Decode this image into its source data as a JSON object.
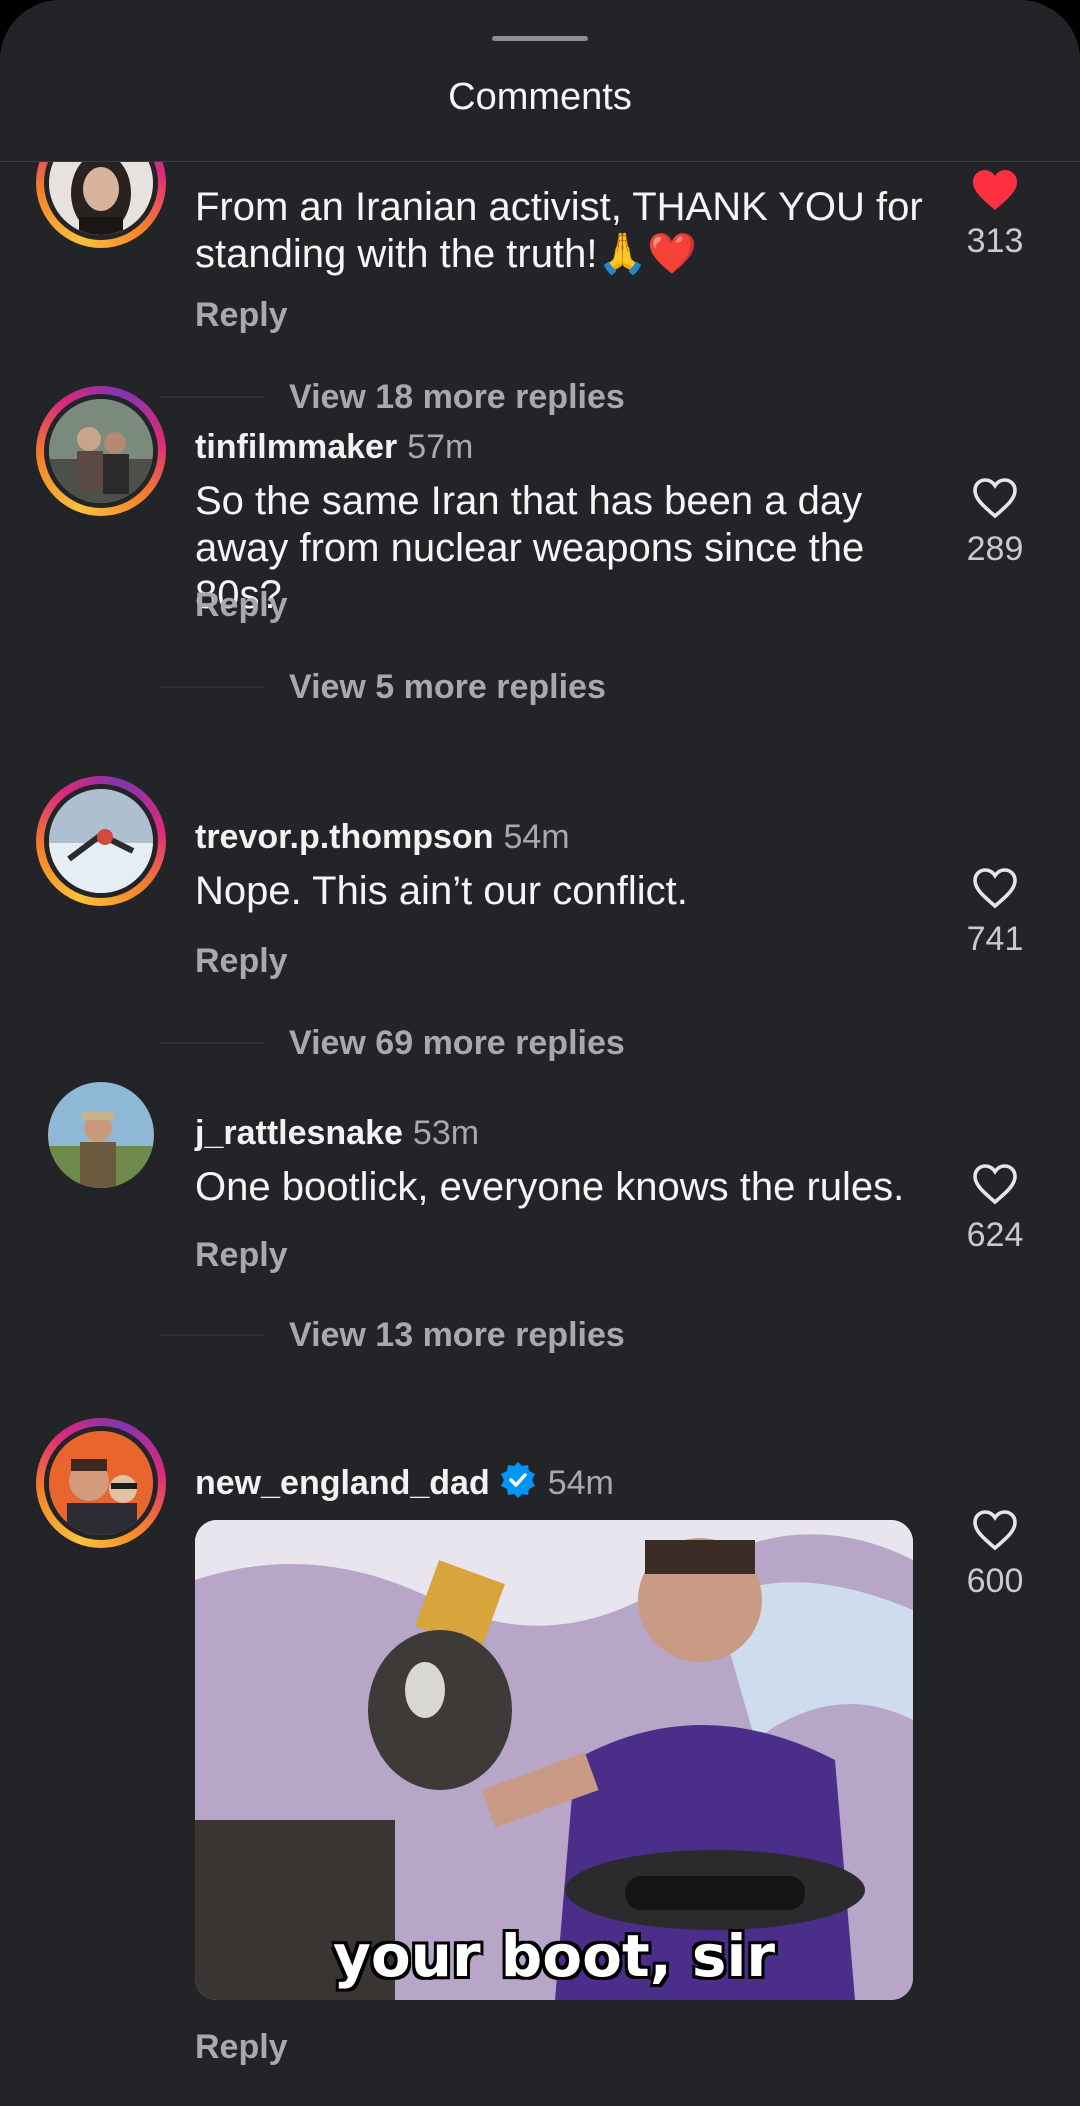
{
  "sheet": {
    "title": "Comments"
  },
  "comments": [
    {
      "username": "",
      "time": "",
      "text": "From an Iranian activist, THANK YOU for standing with the truth!🙏❤️",
      "reply_label": "Reply",
      "likes": "313",
      "liked": true,
      "view_more": "View 18 more replies"
    },
    {
      "username": "tinfilmmaker",
      "time": "57m",
      "text": "So the same Iran that has been a day away from nuclear weapons since the 80s?",
      "reply_label": "Reply",
      "likes": "289",
      "liked": false,
      "view_more": "View 5 more replies"
    },
    {
      "username": "trevor.p.thompson",
      "time": "54m",
      "text": "Nope. This ain’t our conflict.",
      "reply_label": "Reply",
      "likes": "741",
      "liked": false,
      "view_more": "View 69 more replies"
    },
    {
      "username": "j_rattlesnake",
      "time": "53m",
      "text": "One bootlick, everyone knows the rules.",
      "reply_label": "Reply",
      "likes": "624",
      "liked": false,
      "view_more": "View 13 more replies"
    },
    {
      "username": "new_england_dad",
      "time": "54m",
      "verified": true,
      "gif_caption": "your boot, sir",
      "reply_label": "Reply",
      "likes": "600",
      "liked": false
    }
  ],
  "colors": {
    "background": "#232428",
    "liked_heart": "#ff3040",
    "verified_badge": "#0095f6",
    "secondary_text": "#a8a9ad"
  }
}
